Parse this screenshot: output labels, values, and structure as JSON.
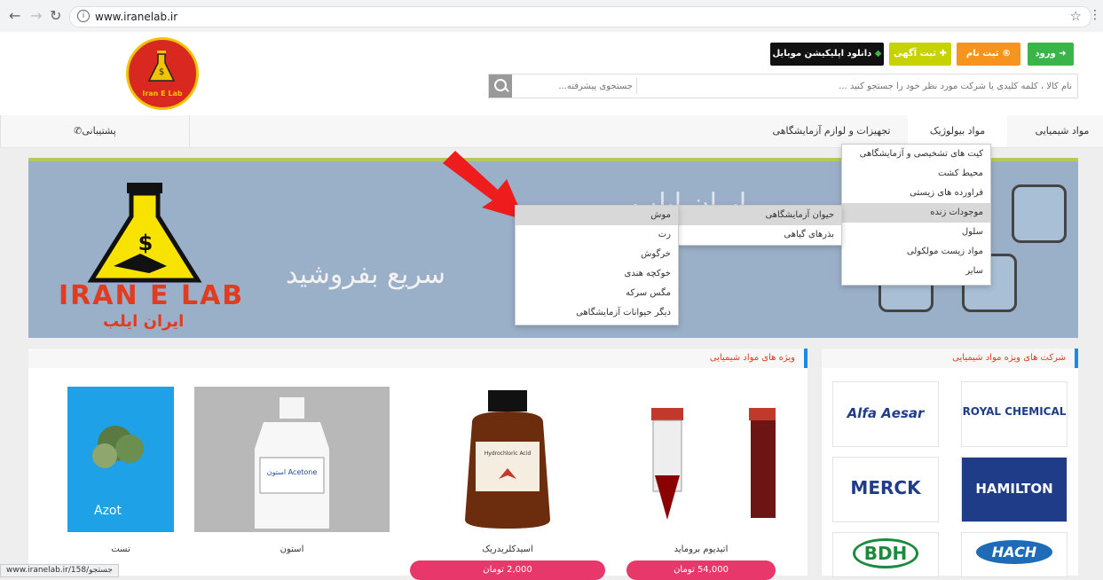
{
  "browser": {
    "url": "www.iranelab.ir"
  },
  "header": {
    "logo_text": "Iran E Lab",
    "buttons": {
      "login": "ورود",
      "signup": "ثبت نام",
      "post_ad": "ثبت آگهی",
      "app": "دانلود اپلیکیشن موبایل"
    },
    "search": {
      "main_placeholder": "نام کالا ، کلمه کلیدی یا شرکت مورد نظر خود را جستجو کنید ...",
      "advanced_placeholder": "جستجوی پیشرفته..."
    }
  },
  "nav": {
    "items": [
      "مواد شیمیایی",
      "مواد بیولوژیک",
      "تجهیزات و لوازم آزمایشگاهی"
    ],
    "support": "پشتیبانی"
  },
  "banner": {
    "brand_en": "IRAN E LAB",
    "brand_fa": "ایران ایلب",
    "slogan": "سریع بفروشید",
    "slogan_top": "ایران ایلب"
  },
  "dropdown": {
    "main": [
      "کیت های تشخیصی و آزمایشگاهی",
      "محیط کشت",
      "فراورده های زیستی",
      "موجودات زنده",
      "سلول",
      "مواد زیست مولکولی",
      "سایر"
    ],
    "sub": [
      "حیوان آزمایشگاهی",
      "بذرهای گیاهی"
    ],
    "sub2": [
      "موش",
      "رت",
      "خرگوش",
      "خوکچه هندی",
      "مگس سرکه",
      "دیگر حیوانات آزمایشگاهی"
    ]
  },
  "sections": {
    "special_chemicals": "ویژه های مواد شیمیایی",
    "special_companies": "شرکت های ویژه مواد شیمیایی"
  },
  "products": [
    {
      "name": "تست",
      "label": "Azot",
      "price": ""
    },
    {
      "name": "استون",
      "label": "Acetone استون",
      "price": ""
    },
    {
      "name": "اسیدکلریدریک",
      "label": "Hydrochloric Acid",
      "price": "2,000 تومان"
    },
    {
      "name": "اتیدیوم بروماید",
      "label": "",
      "price": "54,000 تومان"
    }
  ],
  "brands": [
    "Alfa Aesar",
    "ROYAL CHEMICAL",
    "MERCK",
    "HAMILTON",
    "BDH",
    "HACH"
  ],
  "status_bar": "www.iranelab.ir/158/جستجو",
  "colors": {
    "accent_red": "#e23b1f",
    "login_green": "#3ab54a",
    "signup_orange": "#f7941d",
    "ad_lime": "#c6d300",
    "price_pink": "#e8386b"
  }
}
